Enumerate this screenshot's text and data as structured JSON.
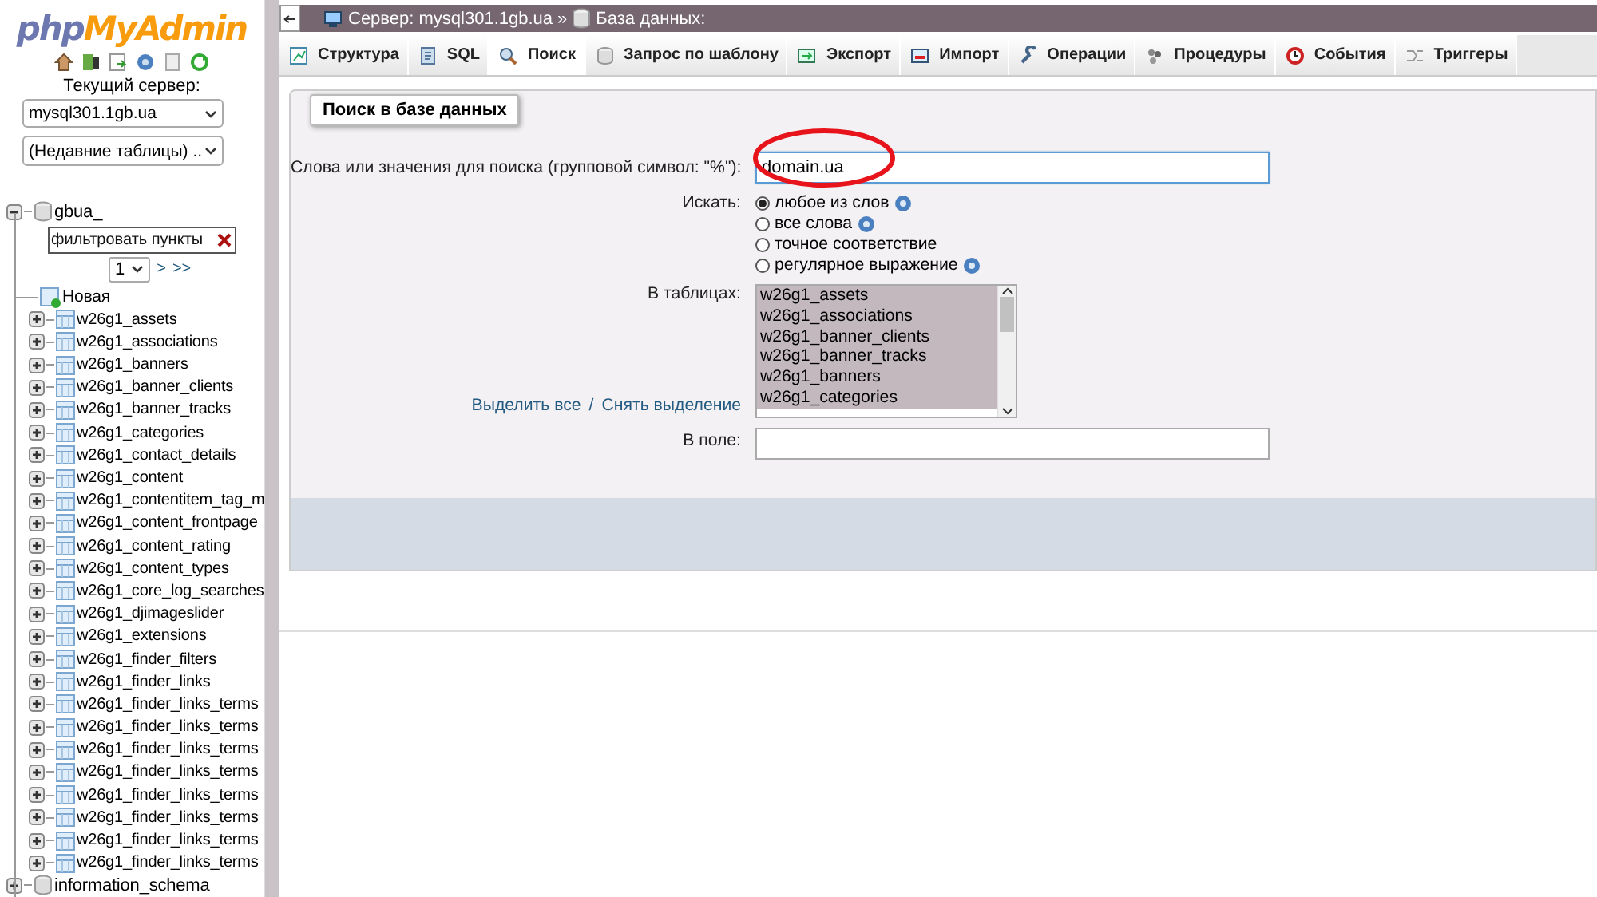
{
  "logo": {
    "part1": "php",
    "part2": "MyAdmin"
  },
  "sidebar": {
    "server_label": "Текущий сервер:",
    "server_select": "mysql301.1gb.ua",
    "recent_select": "(Недавние таблицы) ..",
    "databases": [
      {
        "name": "gbua_",
        "expanded": true,
        "filter_placeholder": "фильтровать пункты",
        "page_select": "1",
        "page_next": ">",
        "page_last": ">>",
        "new_item": "Новая",
        "tables": [
          "w26g1_assets",
          "w26g1_associations",
          "w26g1_banners",
          "w26g1_banner_clients",
          "w26g1_banner_tracks",
          "w26g1_categories",
          "w26g1_contact_details",
          "w26g1_content",
          "w26g1_contentitem_tag_m",
          "w26g1_content_frontpage",
          "w26g1_content_rating",
          "w26g1_content_types",
          "w26g1_core_log_searches",
          "w26g1_djimageslider",
          "w26g1_extensions",
          "w26g1_finder_filters",
          "w26g1_finder_links",
          "w26g1_finder_links_terms",
          "w26g1_finder_links_terms",
          "w26g1_finder_links_terms",
          "w26g1_finder_links_terms",
          "w26g1_finder_links_terms",
          "w26g1_finder_links_terms",
          "w26g1_finder_links_terms",
          "w26g1_finder_links_terms"
        ]
      },
      {
        "name": "information_schema",
        "expanded": false
      }
    ]
  },
  "breadcrumb": {
    "items": [
      {
        "kind": "server",
        "text": "Сервер: mysql301.1gb.ua"
      },
      {
        "kind": "database",
        "text": "База данных:"
      }
    ],
    "separator": "»"
  },
  "tabs": [
    {
      "label": "Структура",
      "selected": false
    },
    {
      "label": "SQL",
      "selected": false
    },
    {
      "label": "Поиск",
      "selected": true
    },
    {
      "label": "Запрос по шаблону",
      "selected": false
    },
    {
      "label": "Экспорт",
      "selected": false
    },
    {
      "label": "Импорт",
      "selected": false
    },
    {
      "label": "Операции",
      "selected": false
    },
    {
      "label": "Процедуры",
      "selected": false
    },
    {
      "label": "События",
      "selected": false
    },
    {
      "label": "Триггеры",
      "selected": false
    }
  ],
  "search": {
    "legend": "Поиск в базе данных",
    "words_label": "Слова или значения для поиска (групповой символ: \"%\"):",
    "words_value": "domain.ua",
    "mode_label": "Искать:",
    "modes": [
      {
        "label": "любое из слов",
        "selected": true,
        "help": true
      },
      {
        "label": "все слова",
        "selected": false,
        "help": true
      },
      {
        "label": "точное соответствие",
        "selected": false,
        "help": false
      },
      {
        "label": "регулярное выражение",
        "selected": false,
        "help": true
      }
    ],
    "tables_label": "В таблицах:",
    "tables": [
      {
        "name": "w26g1_assets",
        "selected": true
      },
      {
        "name": "w26g1_associations",
        "selected": true
      },
      {
        "name": "w26g1_banner_clients",
        "selected": true
      },
      {
        "name": "w26g1_banner_tracks",
        "selected": true
      },
      {
        "name": "w26g1_banners",
        "selected": true
      },
      {
        "name": "w26g1_categories",
        "selected": true
      }
    ],
    "select_all": "Выделить все",
    "link_separator": "/",
    "deselect_all": "Снять выделение",
    "field_label": "В поле:"
  },
  "annotation": {
    "kind": "ellipse",
    "color": "#e8141b"
  }
}
